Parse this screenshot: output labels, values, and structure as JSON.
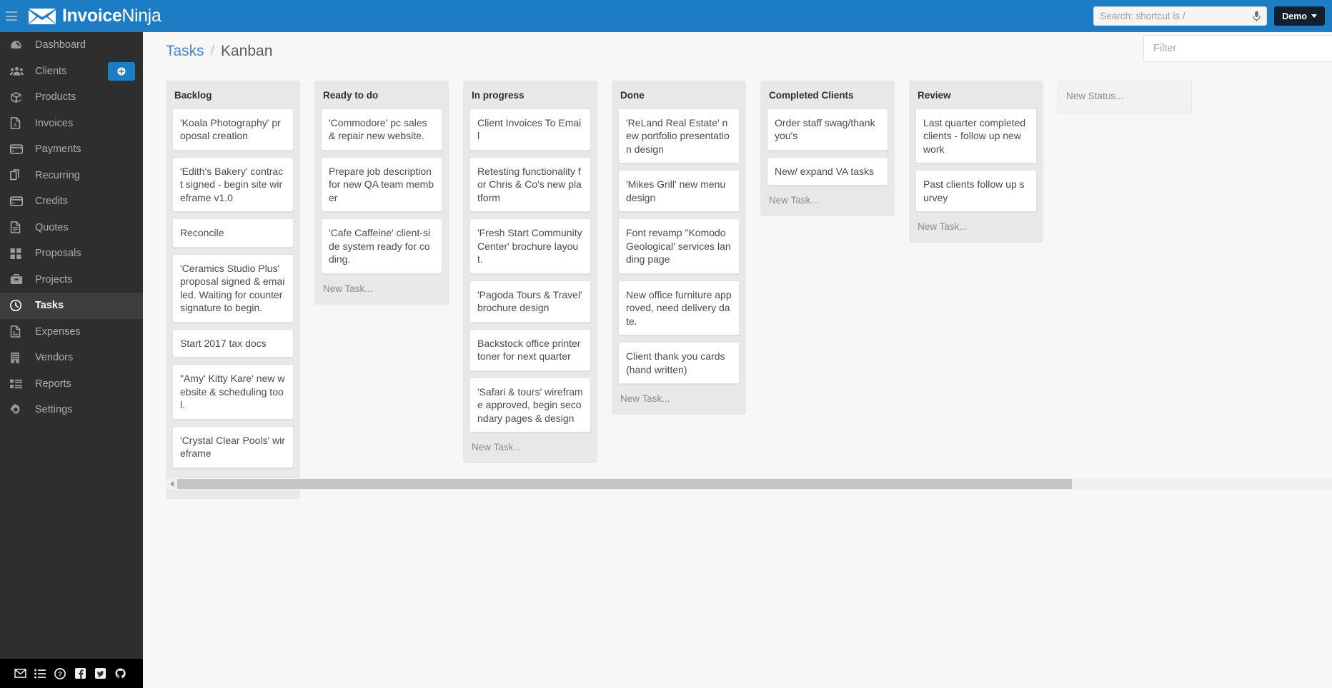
{
  "topbar": {
    "menu_icon": "hamburger-icon",
    "brand_bold": "Invoice",
    "brand_light": "Ninja",
    "brand_icon": "envelope-logo-icon",
    "search_placeholder": "Search: shortcut is /",
    "search_value": "",
    "mic_icon": "microphone-icon",
    "account_label": "Demo",
    "caret_icon": "chevron-down-icon"
  },
  "sidebar": {
    "items": [
      {
        "label": "Dashboard",
        "icon": "dashboard-icon",
        "active": false
      },
      {
        "label": "Clients",
        "icon": "users-icon",
        "active": false,
        "has_add": true
      },
      {
        "label": "Products",
        "icon": "box-icon",
        "active": false
      },
      {
        "label": "Invoices",
        "icon": "file-pdf-icon",
        "active": false
      },
      {
        "label": "Payments",
        "icon": "credit-card-icon",
        "active": false
      },
      {
        "label": "Recurring",
        "icon": "copy-icon",
        "active": false
      },
      {
        "label": "Credits",
        "icon": "credit-card-icon",
        "active": false
      },
      {
        "label": "Quotes",
        "icon": "file-text-icon",
        "active": false
      },
      {
        "label": "Proposals",
        "icon": "grid-icon",
        "active": false
      },
      {
        "label": "Projects",
        "icon": "briefcase-icon",
        "active": false
      },
      {
        "label": "Tasks",
        "icon": "clock-icon",
        "active": true
      },
      {
        "label": "Expenses",
        "icon": "file-image-icon",
        "active": false
      },
      {
        "label": "Vendors",
        "icon": "building-icon",
        "active": false
      },
      {
        "label": "Reports",
        "icon": "list-icon",
        "active": false
      },
      {
        "label": "Settings",
        "icon": "gear-icon",
        "active": false
      }
    ],
    "add_button_icon": "plus-circle-icon",
    "footer_icons": [
      "envelope-icon",
      "list-icon",
      "question-circle-icon",
      "facebook-icon",
      "twitter-icon",
      "github-icon"
    ]
  },
  "header": {
    "breadcrumb_link": "Tasks",
    "breadcrumb_sep": "/",
    "breadcrumb_current": "Kanban",
    "filter_placeholder": "Filter",
    "filter_value": ""
  },
  "board": {
    "new_task_label": "New Task...",
    "new_status_placeholder": "New Status...",
    "columns": [
      {
        "title": "Backlog",
        "cards": [
          "'Koala Photography' proposal creation",
          "'Edith's Bakery' contract signed - begin site wireframe v1.0",
          "Reconcile",
          "'Ceramics Studio Plus' proposal signed & emailed. Waiting for countersignature to begin.",
          "Start 2017 tax docs",
          "\"Amy' Kitty Kare' new website & scheduling tool.",
          "'Crystal Clear Pools' wireframe"
        ]
      },
      {
        "title": "Ready to do",
        "cards": [
          "'Commodore' pc sales & repair new website.",
          "Prepare job description for new QA team member",
          "'Cafe Caffeine' client-side system ready for coding."
        ]
      },
      {
        "title": "In progress",
        "cards": [
          "Client Invoices To Email",
          "Retesting functionality for Chris & Co's new platform",
          "'Fresh Start Community Center' brochure layout.",
          "'Pagoda Tours & Travel' brochure design",
          "Backstock office printer toner for next quarter",
          "'Safari & tours' wireframe approved, begin secondary pages & design"
        ]
      },
      {
        "title": "Done",
        "cards": [
          "'ReLand Real Estate' new portfolio presentation design",
          "'Mikes Grill' new menu design",
          "Font revamp \"Komodo Geological' services landing page",
          "New office furniture approved, need delivery date.",
          "Client thank you cards (hand written)"
        ]
      },
      {
        "title": "Completed Clients",
        "cards": [
          "Order staff swag/thank you's",
          "New/ expand VA tasks"
        ]
      },
      {
        "title": "Review",
        "cards": [
          "Last quarter completed clients - follow up new work",
          "Past clients follow up survey"
        ]
      }
    ]
  },
  "scrollbar": {
    "left_arrow_icon": "caret-left-icon"
  },
  "colors": {
    "brand_blue": "#1c7dc4",
    "sidebar_bg": "#2e2e2e",
    "sidebar_active": "#3d3d3d",
    "column_bg": "#e8e8e8",
    "card_bg": "#ffffff",
    "link_blue": "#4a86c7",
    "account_btn": "#141f2e"
  }
}
